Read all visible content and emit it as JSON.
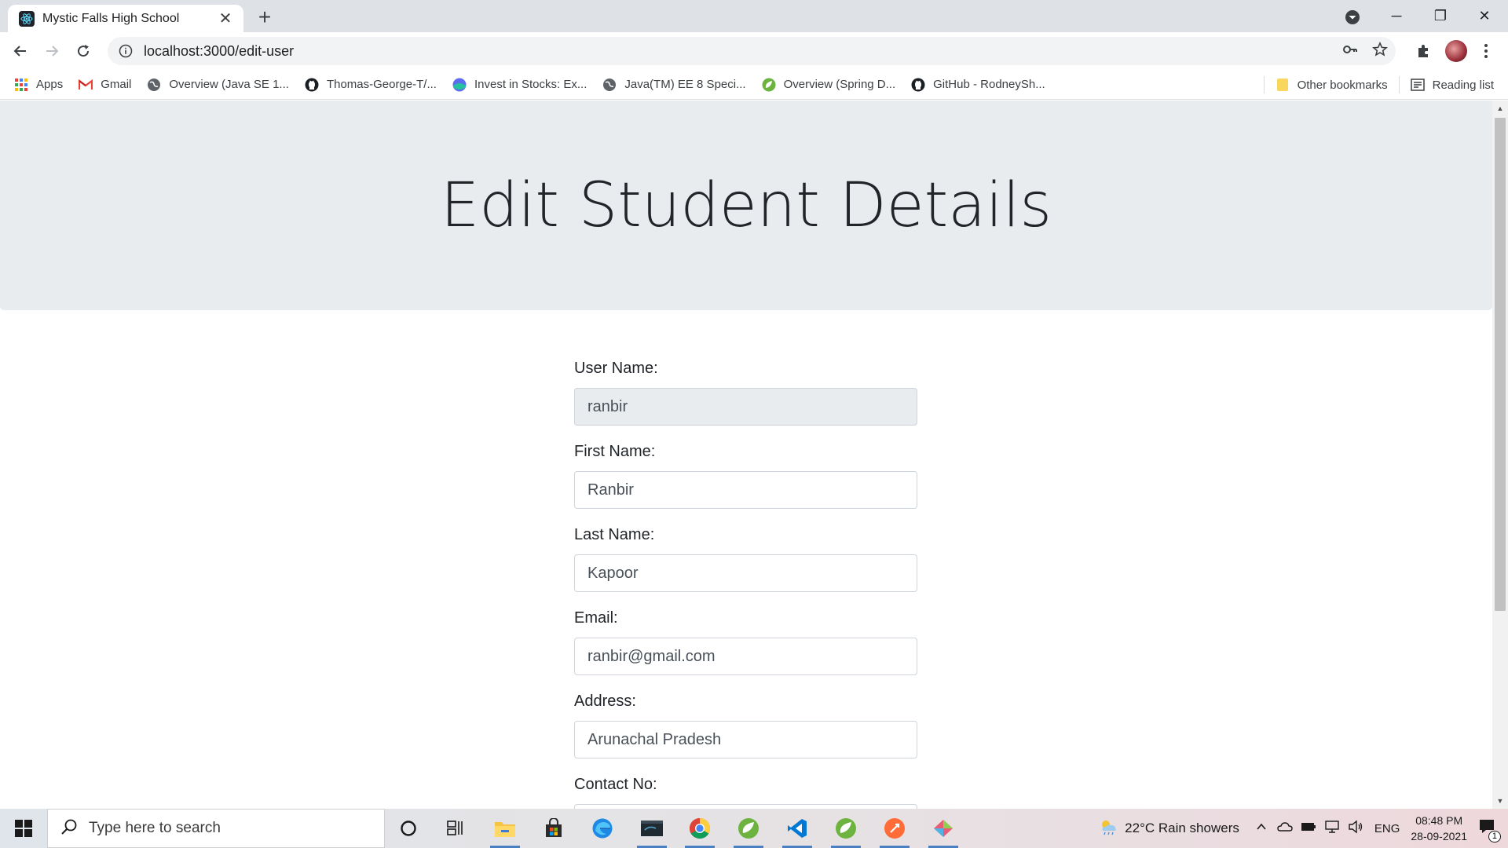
{
  "browser": {
    "tab_title": "Mystic Falls High School",
    "tab_close": "✕",
    "new_tab": "+",
    "url": "localhost:3000/edit-user",
    "controls": {
      "minimize": "─",
      "maximize": "❐",
      "close": "✕"
    }
  },
  "bookmarks": {
    "items": [
      {
        "label": "Apps",
        "icon": "apps-grid-icon"
      },
      {
        "label": "Gmail",
        "icon": "gmail-icon"
      },
      {
        "label": "Overview (Java SE 1...",
        "icon": "globe-icon"
      },
      {
        "label": "Thomas-George-T/...",
        "icon": "github-icon"
      },
      {
        "label": "Invest in Stocks: Ex...",
        "icon": "stocks-icon"
      },
      {
        "label": "Java(TM) EE 8 Speci...",
        "icon": "globe-icon"
      },
      {
        "label": "Overview (Spring D...",
        "icon": "spring-icon"
      },
      {
        "label": "GitHub - RodneySh...",
        "icon": "github-icon"
      }
    ],
    "other_bookmarks": "Other bookmarks",
    "reading_list": "Reading list"
  },
  "page": {
    "heading": "Edit Student Details",
    "fields": [
      {
        "label": "User Name:",
        "value": "ranbir",
        "readonly": true
      },
      {
        "label": "First Name:",
        "value": "Ranbir"
      },
      {
        "label": "Last Name:",
        "value": "Kapoor"
      },
      {
        "label": "Email:",
        "value": "ranbir@gmail.com"
      },
      {
        "label": "Address:",
        "value": "Arunachal Pradesh"
      },
      {
        "label": "Contact No:",
        "value": ""
      }
    ]
  },
  "taskbar": {
    "search_placeholder": "Type here to search",
    "weather": "22°C  Rain showers",
    "language": "ENG",
    "time": "08:48 PM",
    "date": "28-09-2021",
    "notification_count": "1",
    "apps": [
      "cortana-icon",
      "task-view-icon",
      "file-explorer-icon",
      "store-icon",
      "edge-icon",
      "mysql-icon",
      "chrome-icon",
      "spring-tool-icon",
      "vscode-icon",
      "spring-tool-icon",
      "postman-icon",
      "git-icon"
    ]
  },
  "colors": {
    "jumbotron_bg": "#e9ecef",
    "input_border": "#ced4da",
    "readonly_bg": "#e9ecef",
    "tabstrip_bg": "#dee1e6"
  }
}
